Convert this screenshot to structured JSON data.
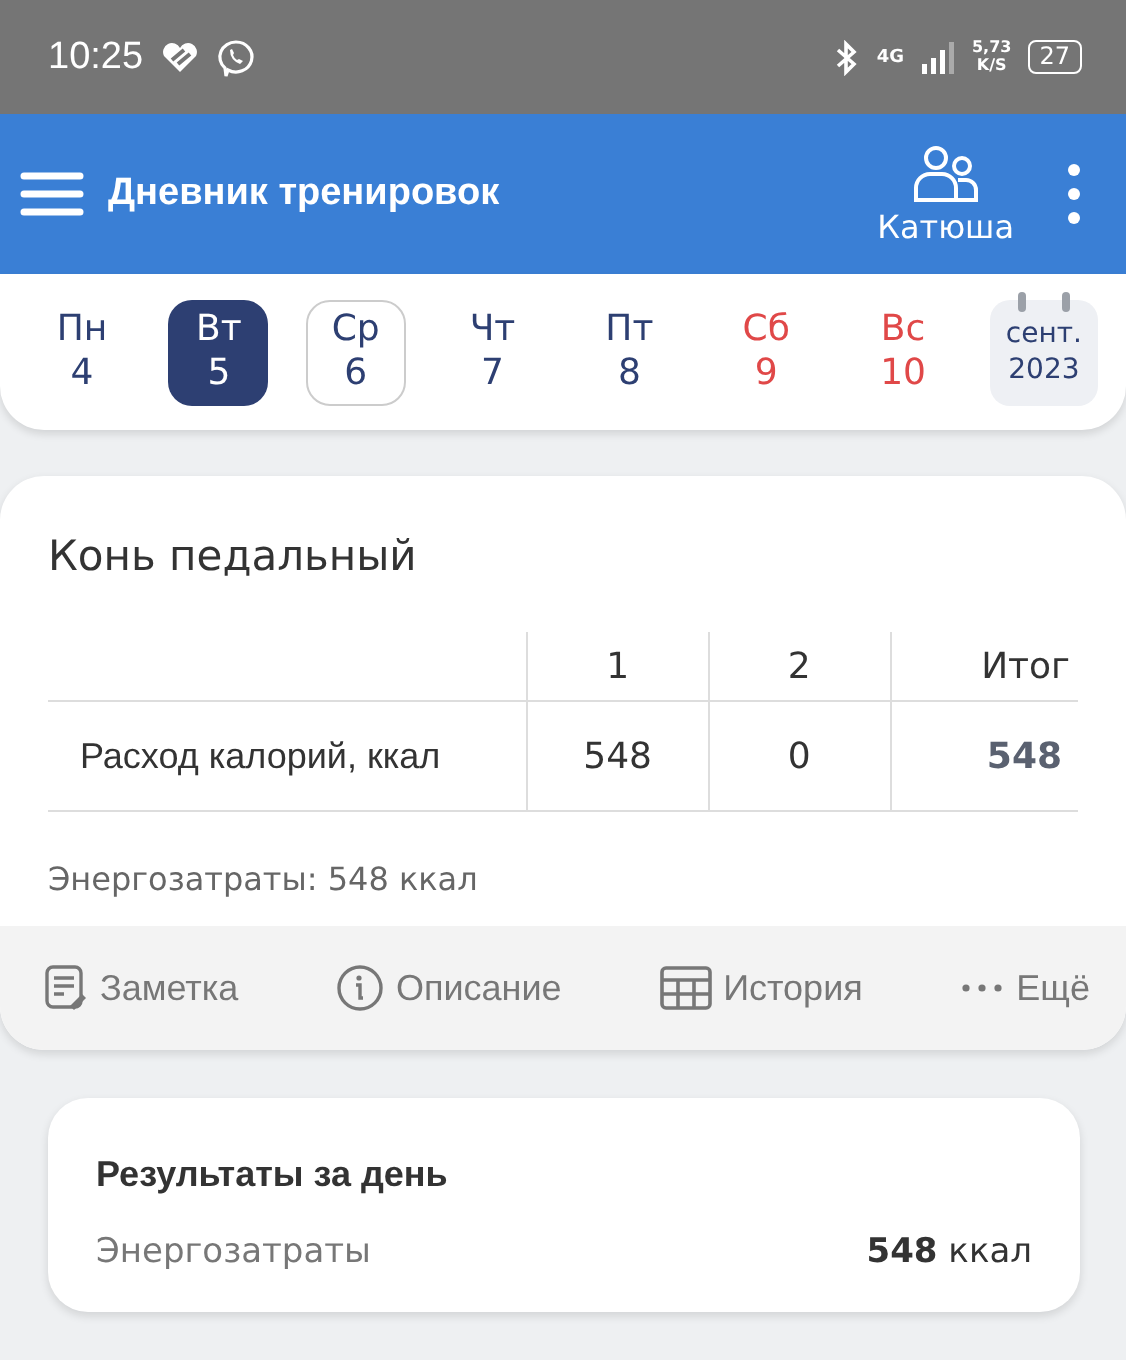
{
  "status_bar": {
    "time": "10:25",
    "network": "4G",
    "speed": "5,73",
    "speed_unit": "K/S",
    "battery": "27"
  },
  "app_bar": {
    "title": "Дневник тренировок",
    "profile": "Катюша"
  },
  "days": [
    {
      "weekday": "Пн",
      "day": "4",
      "selected": false,
      "today": false,
      "weekend": false
    },
    {
      "weekday": "Вт",
      "day": "5",
      "selected": true,
      "today": false,
      "weekend": false
    },
    {
      "weekday": "Ср",
      "day": "6",
      "selected": false,
      "today": true,
      "weekend": false
    },
    {
      "weekday": "Чт",
      "day": "7",
      "selected": false,
      "today": false,
      "weekend": false
    },
    {
      "weekday": "Пт",
      "day": "8",
      "selected": false,
      "today": false,
      "weekend": false
    },
    {
      "weekday": "Сб",
      "day": "9",
      "selected": false,
      "today": false,
      "weekend": true
    },
    {
      "weekday": "Вс",
      "day": "10",
      "selected": false,
      "today": false,
      "weekend": true
    }
  ],
  "month": {
    "month": "сент.",
    "year": "2023"
  },
  "exercise": {
    "title": "Конь педальный",
    "table": {
      "columns": [
        "1",
        "2",
        "Итог"
      ],
      "rows": [
        {
          "label": "Расход калорий, ккал",
          "values": [
            "548",
            "0",
            "548"
          ]
        }
      ]
    },
    "summary": "Энергозатраты: 548 ккал",
    "actions": [
      {
        "kind": "note",
        "label": "Заметка"
      },
      {
        "kind": "info",
        "label": "Описание"
      },
      {
        "kind": "history",
        "label": "История"
      },
      {
        "kind": "more",
        "label": "Ещё"
      }
    ]
  },
  "day_results": {
    "title": "Результаты за день",
    "rows": [
      {
        "label": "Энергозатраты",
        "value": "**548** ккал"
      }
    ]
  }
}
